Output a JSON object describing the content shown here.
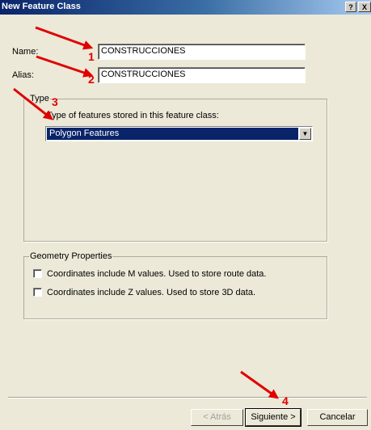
{
  "window": {
    "title": "New Feature Class",
    "help_button": "?",
    "close_button": "X"
  },
  "form": {
    "name_label": "Name:",
    "name_value": "CONSTRUCCIONES",
    "alias_label": "Alias:",
    "alias_value": "CONSTRUCCIONES"
  },
  "type_group": {
    "legend": "Type",
    "description": "Type of features stored in this feature class:",
    "selected": "Polygon Features"
  },
  "geometry_group": {
    "legend": "Geometry Properties",
    "options": [
      {
        "label": "Coordinates include M values. Used to store route data.",
        "checked": false
      },
      {
        "label": "Coordinates include Z values. Used to store 3D data.",
        "checked": false
      }
    ]
  },
  "buttons": {
    "back": "< Atrás",
    "next": "Siguiente >",
    "cancel": "Cancelar"
  },
  "annotations": {
    "step1": "1",
    "step2": "2",
    "step3": "3",
    "step4": "4",
    "color": "#e00000"
  }
}
